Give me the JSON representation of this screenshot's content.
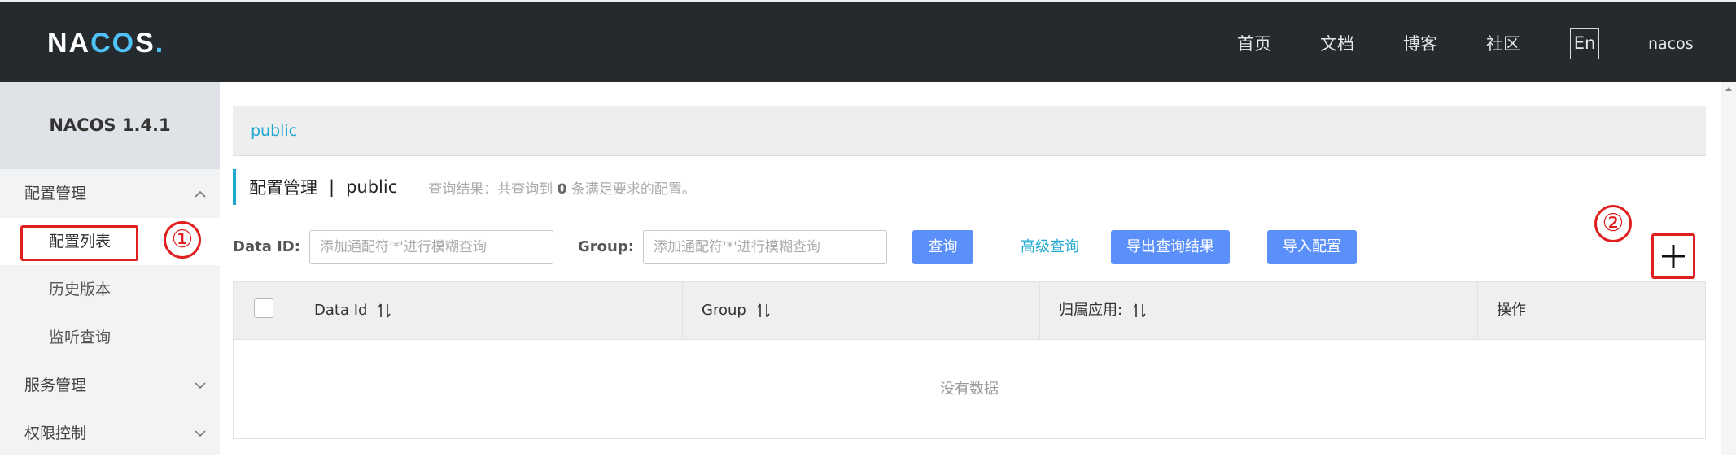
{
  "app": {
    "logo_text_1": "NA",
    "logo_text_2": "CO",
    "logo_text_3": "S",
    "logo_dot": "."
  },
  "nav": {
    "home": "首页",
    "docs": "文档",
    "blog": "博客",
    "community": "社区",
    "lang": "En",
    "user": "nacos"
  },
  "sidebar": {
    "version": "NACOS 1.4.1",
    "groups": [
      {
        "label": "配置管理",
        "expanded": true
      },
      {
        "label": "服务管理",
        "expanded": false
      },
      {
        "label": "权限控制",
        "expanded": false
      }
    ],
    "config_items": [
      "配置列表",
      "历史版本",
      "监听查询"
    ]
  },
  "annotations": {
    "one": "①",
    "two": "②"
  },
  "namespace": {
    "current": "public"
  },
  "page": {
    "title": "配置管理",
    "separator": "|",
    "namespace": "public",
    "result_prefix": "查询结果：共查询到",
    "result_count": "0",
    "result_suffix": "条满足要求的配置。"
  },
  "filters": {
    "data_id_label": "Data ID:",
    "data_id_placeholder": "添加通配符'*'进行模糊查询",
    "group_label": "Group:",
    "group_placeholder": "添加通配符'*'进行模糊查询",
    "query_button": "查询",
    "advanced_query": "高级查询",
    "export_button": "导出查询结果",
    "import_button": "导入配置"
  },
  "table": {
    "columns": [
      "Data Id",
      "Group",
      "归属应用:",
      "操作"
    ],
    "empty_text": "没有数据"
  },
  "colors": {
    "topbar": "#252a2f",
    "accent": "#1fa8d1",
    "primary_button": "#5b8ff9",
    "annotation_red": "#e02020"
  }
}
